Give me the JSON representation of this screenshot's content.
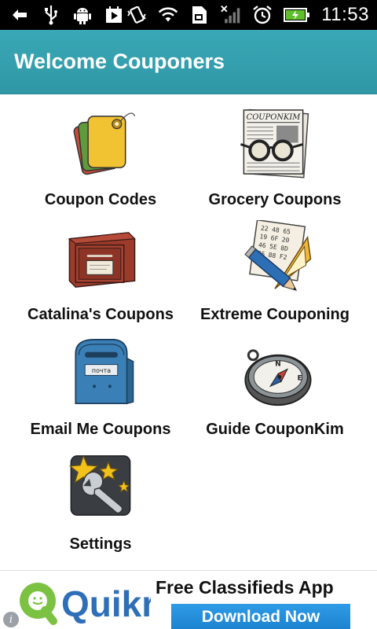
{
  "status_bar": {
    "time": "11:53",
    "icons": [
      "back-icon",
      "usb-icon",
      "android-debug-icon",
      "play-store-icon",
      "vibrate-icon",
      "wifi-icon",
      "sd-card-icon",
      "no-signal-icon",
      "alarm-icon",
      "battery-charging-icon"
    ]
  },
  "header": {
    "title": "Welcome Couponers"
  },
  "menu": {
    "items": [
      {
        "label": "Coupon Codes",
        "icon": "coupon-tags-icon"
      },
      {
        "label": "Grocery Coupons",
        "icon": "newspaper-glasses-icon"
      },
      {
        "label": "Catalina's Coupons",
        "icon": "file-drawer-icon"
      },
      {
        "label": "Extreme Couponing",
        "icon": "pencil-ruler-icon"
      },
      {
        "label": "Email Me Coupons",
        "icon": "mailbox-icon"
      },
      {
        "label": "Guide CouponKim",
        "icon": "compass-icon"
      },
      {
        "label": "Settings",
        "icon": "wrench-stars-icon"
      }
    ]
  },
  "ad": {
    "brand": "Quikr",
    "title": "Free Classifieds App",
    "button": "Download Now",
    "info": "i"
  },
  "colors": {
    "header": "#2f97a6",
    "ad_button": "#1c82cf",
    "brand_blue": "#2f6fb8",
    "brand_green": "#7cc242"
  },
  "art_text": {
    "newspaper_masthead": "COUPONKIM",
    "mailbox_label": "почта"
  }
}
